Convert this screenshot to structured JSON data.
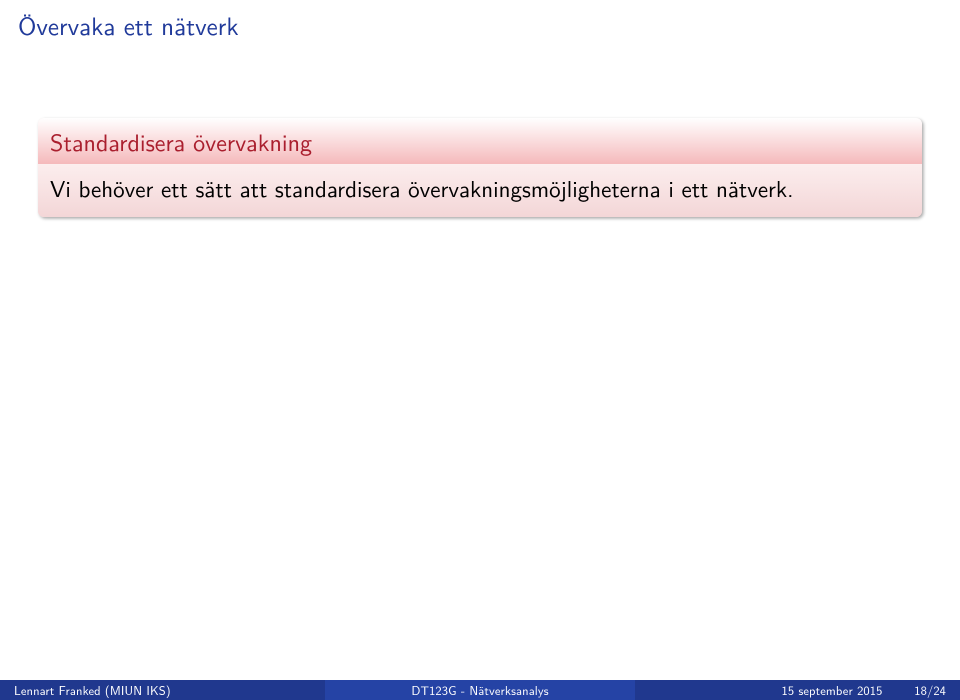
{
  "slide": {
    "title": "Övervaka ett nätverk",
    "block": {
      "title": "Standardisera övervakning",
      "body": "Vi behöver ett sätt att standardisera övervakningsmöjligheterna i ett nätverk."
    }
  },
  "footer": {
    "author": "Lennart Franked (MIUN IKS)",
    "course": "DT123G - Nätverksanalys",
    "date": "15 september 2015",
    "page_current": "18",
    "page_sep": " / ",
    "page_total": "24"
  }
}
